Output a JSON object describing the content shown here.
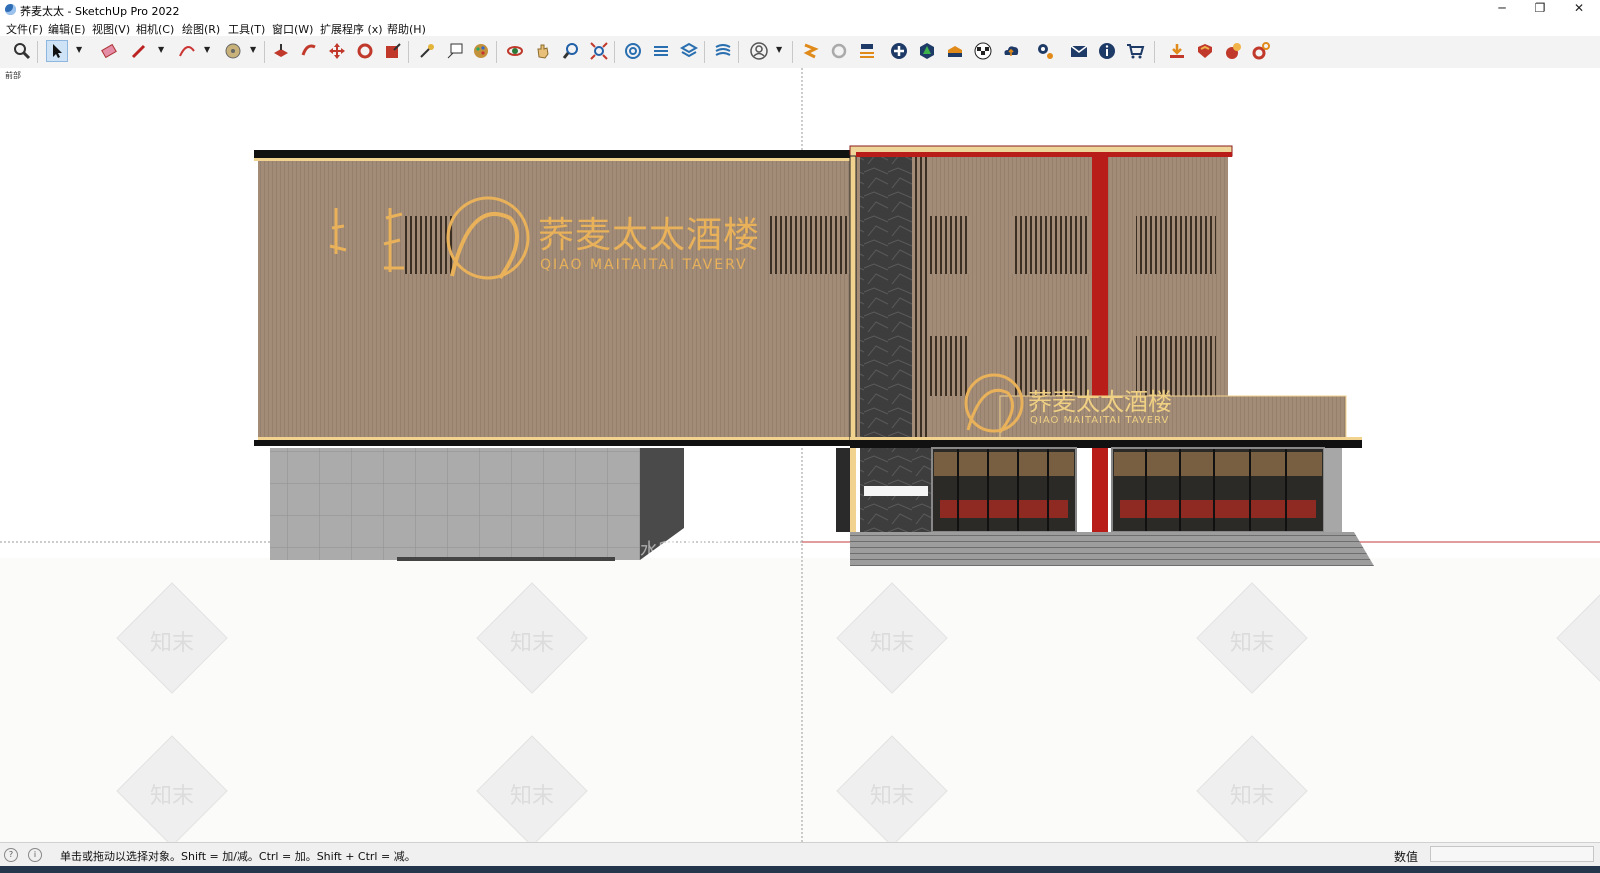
{
  "window": {
    "title": "荞麦太太 - SketchUp Pro 2022",
    "controls": {
      "minimize": "─",
      "restore": "❐",
      "close": "✕"
    }
  },
  "menubar": {
    "items": [
      {
        "label": "文件(F)"
      },
      {
        "label": "编辑(E)"
      },
      {
        "label": "视图(V)"
      },
      {
        "label": "相机(C)"
      },
      {
        "label": "绘图(R)"
      },
      {
        "label": "工具(T)"
      },
      {
        "label": "窗口(W)"
      },
      {
        "label": "扩展程序 (x)"
      },
      {
        "label": "帮助(H)"
      }
    ]
  },
  "toolbar": {
    "icons": [
      "zoom-icon",
      "select-icon",
      "eraser-icon",
      "pencil-icon",
      "arc-icon",
      "paint-bucket-icon",
      "push-pull-icon",
      "follow-me-icon",
      "move-icon",
      "rotate-icon",
      "scale-icon",
      "tape-measure-icon",
      "text-icon",
      "paint-icon",
      "orbit-icon",
      "pan-icon",
      "zoom-window-icon",
      "zoom-extents-icon",
      "component-icon",
      "layer-icon",
      "layer-2-icon",
      "sandbox-icon",
      "user-icon",
      "ext-1-icon",
      "ext-refresh-icon",
      "ext-3-icon",
      "add-icon",
      "tree-icon",
      "ext-4-icon",
      "checker-icon",
      "cloud-icon",
      "settings-icon",
      "mail-icon",
      "info-icon",
      "cart-icon",
      "ext-download-icon",
      "ext-shield-icon",
      "ext-fire-icon",
      "ext-gear-icon"
    ]
  },
  "viewport": {
    "scene_label": "前部",
    "signage": {
      "main_cn": "荞麦太太酒楼",
      "main_en": "QIAO MAITAITAI TAVERV",
      "small_cn": "荞麦太太酒楼",
      "small_en": "QIAO MAITAITAI TAVERV"
    },
    "watermark": "知末",
    "overlay_text": "水印部分影响",
    "colors": {
      "facade": "#a28c77",
      "gold": "#e8b15a",
      "red": "#b81d19",
      "stone": "#3f3f3f",
      "grid": "#a8a8a8"
    }
  },
  "statusbar": {
    "hint": "单击或拖动以选择对象。Shift = 加/减。Ctrl = 加。Shift + Ctrl = 减。",
    "measurements_label": "数值",
    "measurements_value": ""
  }
}
